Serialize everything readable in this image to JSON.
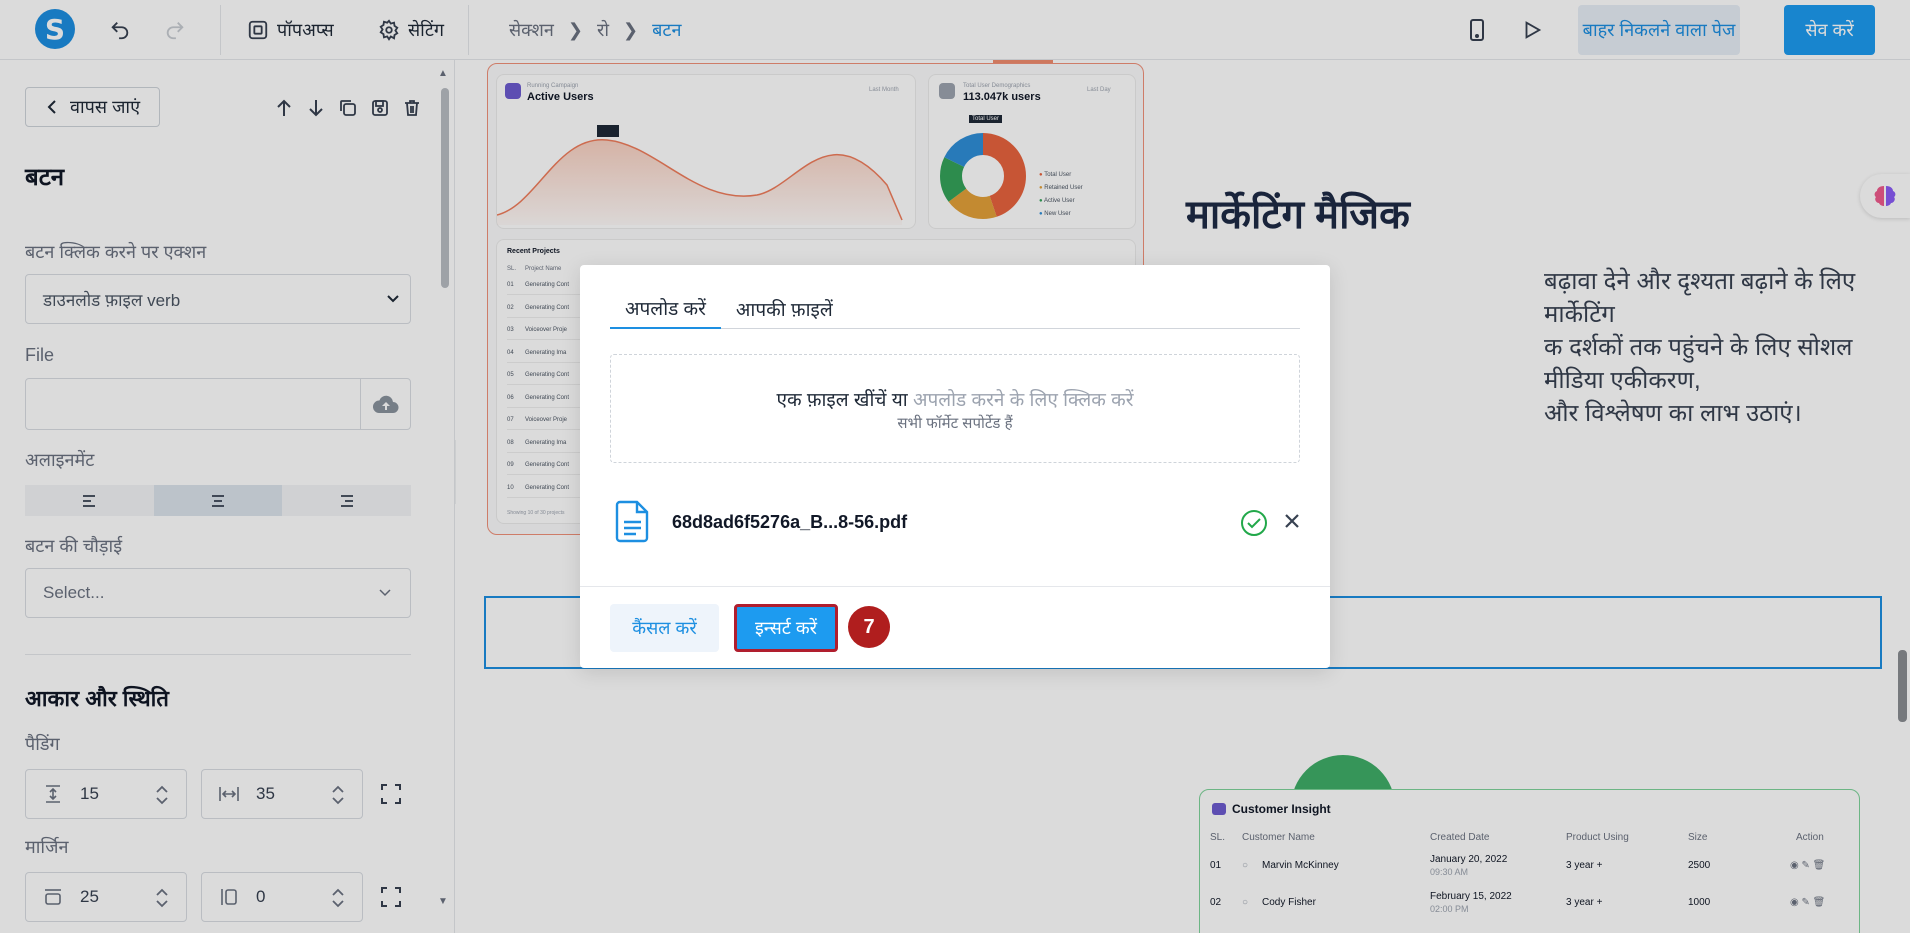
{
  "topbar": {
    "logo_letter": "S",
    "popups_label": "पॉपअप्स",
    "settings_label": "सेटिंग",
    "breadcrumb": [
      "सेक्शन",
      "रो",
      "बटन"
    ],
    "exit_page_label": "बाहर निकलने वाला पेज",
    "save_label": "सेव करें"
  },
  "left_panel": {
    "back_label": "वापस जाएं",
    "title": "बटन",
    "action_label": "बटन क्लिक करने पर एक्शन",
    "action_value": "डाउनलोड फ़ाइल verb",
    "file_label": "File",
    "alignment_label": "अलाइनमेंट",
    "alignment_selected": "center",
    "width_label": "बटन की चौड़ाई",
    "width_placeholder": "Select...",
    "size_position_label": "आकार और स्थिति",
    "padding_label": "पैडिंग",
    "padding_vertical": "15",
    "padding_horizontal": "35",
    "margin_label": "मार्जिन",
    "margin_top": "25",
    "margin_side": "0"
  },
  "canvas": {
    "dashboard": {
      "running_campaign": "Running Campaign",
      "active_users": "Active Users",
      "last_month": "Last Month",
      "total_user_demographics": "Total User Demographics",
      "total_users": "113.047k users",
      "last_day": "Last Day",
      "tooltip_total_user": "Total User",
      "legend": [
        "Total User",
        "Retained User",
        "Active User",
        "New User"
      ],
      "recent_projects": "Recent Projects",
      "table_head": [
        "SL.",
        "Project Name"
      ],
      "rows": [
        {
          "sl": "01",
          "name": "Generating Cont"
        },
        {
          "sl": "02",
          "name": "Generating Cont"
        },
        {
          "sl": "03",
          "name": "Voiceover Proje"
        },
        {
          "sl": "04",
          "name": "Generating Ima"
        },
        {
          "sl": "05",
          "name": "Generating Cont"
        },
        {
          "sl": "06",
          "name": "Generating Cont"
        },
        {
          "sl": "07",
          "name": "Voiceover Proje"
        },
        {
          "sl": "08",
          "name": "Generating Ima"
        },
        {
          "sl": "09",
          "name": "Generating Cont"
        },
        {
          "sl": "10",
          "name": "Generating Cont"
        }
      ],
      "showing": "Showing 10 of 30 projects"
    },
    "headline": "मार्केटिंग मैजिक",
    "paragraph_lines": [
      "बढ़ावा देने और दृश्यता बढ़ाने के लिए मार्केटिंग",
      "क दर्शकों तक पहुंचने के लिए सोशल मीडिया एकीकरण,",
      "और विश्लेषण का लाभ उठाएं।"
    ],
    "insight": {
      "title": "Customer Insight",
      "columns": [
        "SL.",
        "Customer Name",
        "Created Date",
        "Product Using",
        "Size",
        "Action"
      ],
      "rows": [
        {
          "sl": "01",
          "name": "Marvin McKinney",
          "date": "January 20, 2022",
          "time": "09:30 AM",
          "product": "3 year +",
          "size": "2500"
        },
        {
          "sl": "02",
          "name": "Cody Fisher",
          "date": "February 15, 2022",
          "time": "02:00 PM",
          "product": "3 year +",
          "size": "1000"
        }
      ]
    }
  },
  "modal": {
    "tab_upload": "अपलोड करें",
    "tab_files": "आपकी फ़ाइलें",
    "drop_text": "एक फ़ाइल खींचें या",
    "drop_link": "अपलोड करने के लिए क्लिक करें",
    "drop_sub": "सभी फॉर्मेट सपोर्टेड हैं",
    "file_name": "68d8ad6f5276a_B...8-56.pdf",
    "cancel_label": "कैंसल करें",
    "insert_label": "इन्सर्ट करें"
  },
  "step_badge": "7",
  "colors": {
    "accent": "#1d9bf0",
    "highlight_border": "#b01e2e",
    "success": "#22a84a"
  }
}
